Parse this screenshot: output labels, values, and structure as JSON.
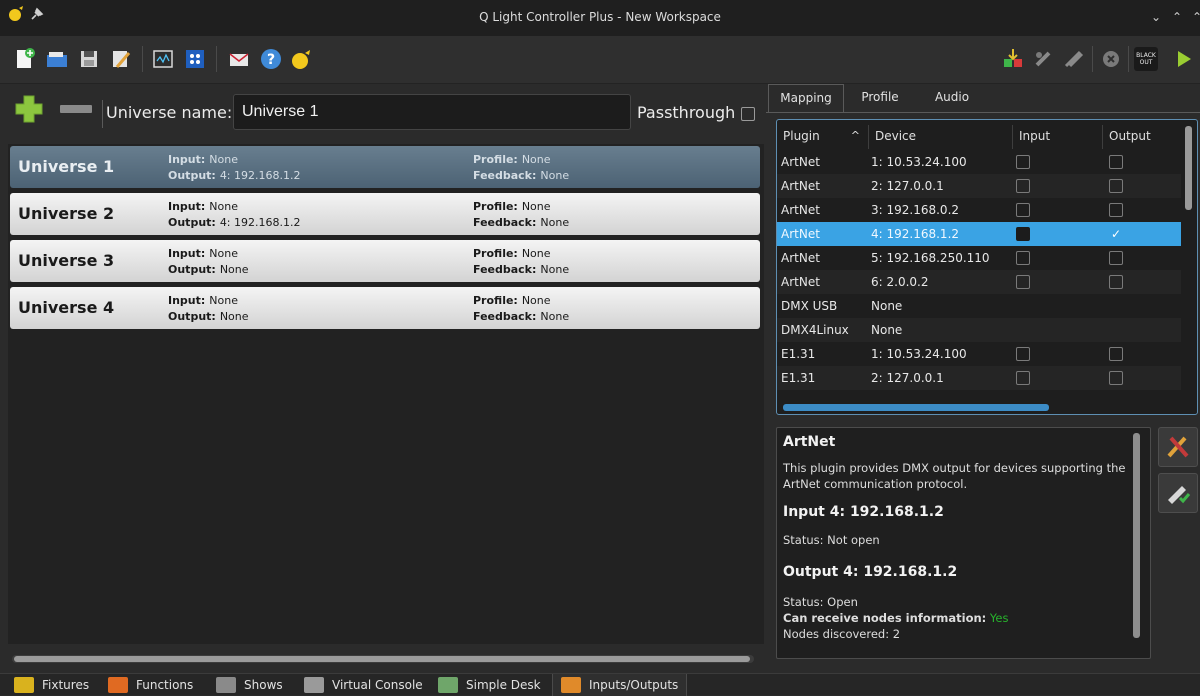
{
  "window": {
    "title": "Q Light Controller Plus - New Workspace",
    "buttons": [
      "⌄",
      "⌃",
      "⌃"
    ]
  },
  "toolbar": {
    "icons": [
      "app-logo-icon",
      "pin-icon",
      "new-workspace-icon",
      "open-workspace-icon",
      "save-workspace-icon",
      "save-as-icon",
      "monitor-icon",
      "address-tool-icon",
      "email-icon",
      "help-icon",
      "about-icon"
    ],
    "right_icons": [
      "dmx-dump-icon",
      "live-edit-icon",
      "operate-mode-icon",
      "stop-all-icon",
      "blackout-icon",
      "play-icon"
    ],
    "blackout_label_line1": "BLACK",
    "blackout_label_line2": "OUT"
  },
  "universe_header": {
    "name_label": "Universe name:",
    "name_value": "Universe 1",
    "passthrough_label": "Passthrough"
  },
  "universes": [
    {
      "name": "Universe 1",
      "input_label": "Input:",
      "input": "None",
      "output_label": "Output:",
      "output": "4: 192.168.1.2",
      "profile_label": "Profile:",
      "profile": "None",
      "feedback_label": "Feedback:",
      "feedback": "None"
    },
    {
      "name": "Universe 2",
      "input_label": "Input:",
      "input": "None",
      "output_label": "Output:",
      "output": "4: 192.168.1.2",
      "profile_label": "Profile:",
      "profile": "None",
      "feedback_label": "Feedback:",
      "feedback": "None"
    },
    {
      "name": "Universe 3",
      "input_label": "Input:",
      "input": "None",
      "output_label": "Output:",
      "output": "None",
      "profile_label": "Profile:",
      "profile": "None",
      "feedback_label": "Feedback:",
      "feedback": "None"
    },
    {
      "name": "Universe 4",
      "input_label": "Input:",
      "input": "None",
      "output_label": "Output:",
      "output": "None",
      "profile_label": "Profile:",
      "profile": "None",
      "feedback_label": "Feedback:",
      "feedback": "None"
    }
  ],
  "right_tabs": [
    "Mapping",
    "Profile",
    "Audio"
  ],
  "mapping": {
    "headers": {
      "plugin": "Plugin",
      "sort_indicator": "^",
      "device": "Device",
      "input": "Input",
      "output": "Output"
    },
    "rows": [
      {
        "plugin": "ArtNet",
        "device": "1: 10.53.24.100",
        "has_input": true,
        "has_output": true,
        "input_checked": false,
        "output_checked": false
      },
      {
        "plugin": "ArtNet",
        "device": "2: 127.0.0.1",
        "has_input": true,
        "has_output": true,
        "input_checked": false,
        "output_checked": false
      },
      {
        "plugin": "ArtNet",
        "device": "3: 192.168.0.2",
        "has_input": true,
        "has_output": true,
        "input_checked": false,
        "output_checked": false
      },
      {
        "plugin": "ArtNet",
        "device": "4: 192.168.1.2",
        "has_input": true,
        "has_output": true,
        "input_checked": false,
        "output_checked": true,
        "selected": true
      },
      {
        "plugin": "ArtNet",
        "device": "5: 192.168.250.110",
        "has_input": true,
        "has_output": true,
        "input_checked": false,
        "output_checked": false
      },
      {
        "plugin": "ArtNet",
        "device": "6: 2.0.0.2",
        "has_input": true,
        "has_output": true,
        "input_checked": false,
        "output_checked": false
      },
      {
        "plugin": "DMX USB",
        "device": "None",
        "has_input": false,
        "has_output": false
      },
      {
        "plugin": "DMX4Linux",
        "device": "None",
        "has_input": false,
        "has_output": false
      },
      {
        "plugin": "E1.31",
        "device": "1: 10.53.24.100",
        "has_input": true,
        "has_output": true,
        "input_checked": false,
        "output_checked": false
      },
      {
        "plugin": "E1.31",
        "device": "2: 127.0.0.1",
        "has_input": true,
        "has_output": true,
        "input_checked": false,
        "output_checked": false
      }
    ]
  },
  "info": {
    "plugin_title": "ArtNet",
    "description": "This plugin provides DMX output for devices supporting the ArtNet communication protocol.",
    "input_title": "Input 4: 192.168.1.2",
    "input_status": "Status: Not open",
    "output_title": "Output 4: 192.168.1.2",
    "output_status": "Status: Open",
    "nodes_label": "Can receive nodes information:",
    "nodes_value": "Yes",
    "nodes_discovered": "Nodes discovered: 2"
  },
  "side_buttons": [
    "configure-plugin-icon",
    "input-profile-icon"
  ],
  "bottom_tabs": [
    {
      "label": "Fixtures",
      "icon": "fixtures-icon",
      "color": "#d9b21e"
    },
    {
      "label": "Functions",
      "icon": "functions-icon",
      "color": "#e06a22"
    },
    {
      "label": "Shows",
      "icon": "shows-icon",
      "color": "#8a8a8a"
    },
    {
      "label": "Virtual Console",
      "icon": "virtual-console-icon",
      "color": "#9a9a9a"
    },
    {
      "label": "Simple Desk",
      "icon": "simple-desk-icon",
      "color": "#6fa66a"
    },
    {
      "label": "Inputs/Outputs",
      "icon": "inputs-outputs-icon",
      "color": "#e08a2a",
      "active": true
    }
  ],
  "colors": {
    "accent": "#3aa3e4",
    "selected_universe": "#566c7e",
    "yes": "#27b42c"
  }
}
